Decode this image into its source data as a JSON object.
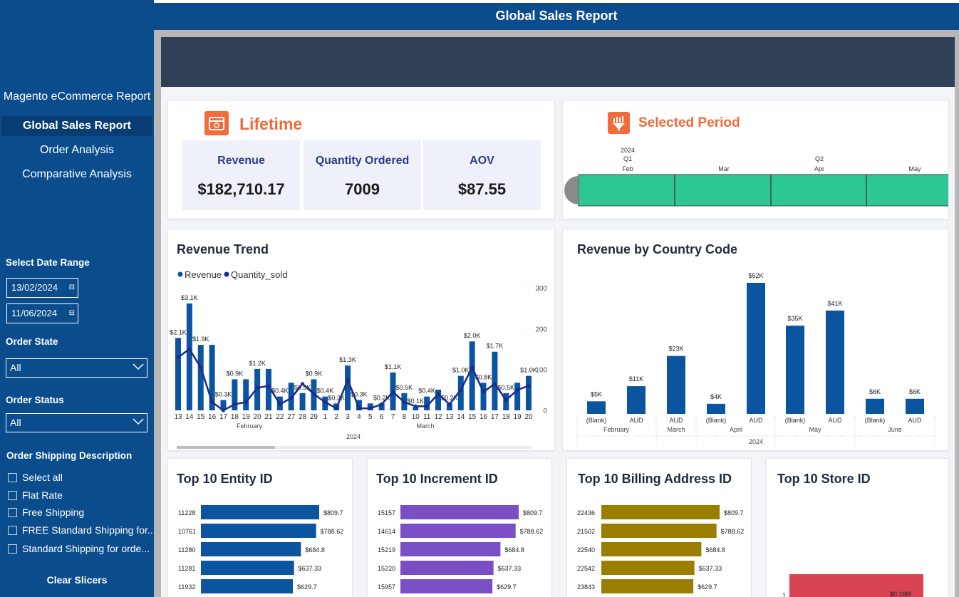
{
  "header": {
    "title": "Global Sales Report"
  },
  "sidebar": {
    "brand": "Magento eCommerce Report",
    "nav": [
      {
        "label": "Global Sales Report",
        "active": true
      },
      {
        "label": "Order Analysis",
        "active": false
      },
      {
        "label": "Comparative Analysis",
        "active": false
      }
    ],
    "date_range_label": "Select Date Range",
    "date_start": "13/02/2024",
    "date_end": "11/06/2024",
    "order_state_label": "Order State",
    "order_state_value": "All",
    "order_status_label": "Order Status",
    "order_status_value": "All",
    "shipping_label": "Order Shipping Description",
    "shipping_options": [
      "Select all",
      "Flat Rate",
      "Free Shipping",
      "FREE Standard Shipping for...",
      "Standard Shipping for orde..."
    ],
    "clear_label": "Clear Slicers"
  },
  "lifetime": {
    "title": "Lifetime",
    "kpis": [
      {
        "label": "Revenue",
        "value": "$182,710.17"
      },
      {
        "label": "Quantity Ordered",
        "value": "7009"
      },
      {
        "label": "AOV",
        "value": "$87.55"
      }
    ]
  },
  "selected_period": {
    "title": "Selected Period",
    "year_label": "2024",
    "quarters": [
      "Q1",
      "Q2"
    ],
    "months": [
      "Feb",
      "Mar",
      "Apr",
      "May"
    ],
    "colors": {
      "fill": "#2dc795",
      "handle": "#8a8a8a"
    }
  },
  "icons": [
    "calendar-icon",
    "period-icon",
    "chevron-down-icon"
  ],
  "colors": {
    "sidebar": "#0a4c8c",
    "accent_orange": "#f06a3a",
    "bar_blue": "#0a54a0",
    "line_navy": "#1c2a8c",
    "purple": "#7a4fc6",
    "olive": "#9a7e00",
    "red": "#d94452"
  },
  "chart_data": [
    {
      "type": "bar+line",
      "title": "Revenue Trend",
      "legend": [
        "Revenue",
        "Quantity_sold"
      ],
      "legend_placement": "top-left",
      "x_groups": [
        "February",
        "March"
      ],
      "x_year": "2024",
      "x": [
        "13",
        "14",
        "15",
        "16",
        "17",
        "18",
        "19",
        "20",
        "21",
        "22",
        "27",
        "28",
        "29",
        "1",
        "2",
        "3",
        "4",
        "5",
        "6",
        "7",
        "8",
        "10",
        "11",
        "12",
        "13",
        "14",
        "15",
        "16",
        "17",
        "18",
        "19",
        "20"
      ],
      "series": [
        {
          "name": "Revenue",
          "values": [
            2100,
            3100,
            1900,
            1900,
            300,
            900,
            900,
            1200,
            1200,
            400,
            800,
            500,
            900,
            400,
            200,
            1300,
            300,
            200,
            200,
            1100,
            500,
            100,
            400,
            600,
            200,
            1000,
            2000,
            800,
            1700,
            500,
            800,
            1000
          ]
        },
        {
          "name": "Quantity_sold",
          "values": [
            130,
            150,
            105,
            20,
            0,
            15,
            20,
            55,
            60,
            15,
            30,
            65,
            40,
            20,
            5,
            75,
            5,
            5,
            15,
            45,
            20,
            10,
            10,
            40,
            15,
            50,
            105,
            45,
            65,
            25,
            50,
            60
          ]
        }
      ],
      "data_labels": [
        "$2.1K",
        "$3.1K",
        "$1.9K",
        "",
        "$0.3K",
        "$0.9K",
        "",
        "$1.2K",
        "",
        "$0.4K",
        "",
        "$0.5K",
        "$0.9K",
        "$0.4K",
        "$0.2K",
        "$1.3K",
        "$0.3K",
        "",
        "$0.2K",
        "$1.1K",
        "$0.5K",
        "$0.1K",
        "$0.4K",
        "",
        "$0.2K",
        "$1.0K",
        "$2.0K",
        "$0.8K",
        "$1.7K",
        "$0.5K",
        "",
        "$1.0K"
      ],
      "y2_ticks": [
        0,
        100,
        200,
        300
      ]
    },
    {
      "type": "bar",
      "title": "Revenue by Country Code",
      "categories": [
        "(Blank)",
        "AUD",
        "AUD",
        "(Blank)",
        "AUD",
        "(Blank)",
        "AUD",
        "(Blank)",
        "AUD"
      ],
      "groups": [
        {
          "name": "February",
          "span": 2
        },
        {
          "name": "March",
          "span": 1
        },
        {
          "name": "April",
          "span": 2
        },
        {
          "name": "May",
          "span": 2
        },
        {
          "name": "June",
          "span": 2
        }
      ],
      "x_year": "2024",
      "values": [
        5000,
        11000,
        23000,
        4000,
        52000,
        35000,
        41000,
        6000,
        6000
      ],
      "labels": [
        "$5K",
        "$11K",
        "$23K",
        "$4K",
        "$52K",
        "$35K",
        "$41K",
        "$6K",
        "$6K"
      ]
    },
    {
      "type": "hbar",
      "title": "Top 10 Entity ID",
      "categories": [
        "11228",
        "10761",
        "11280",
        "11281",
        "11932"
      ],
      "values": [
        809.7,
        788.62,
        684.8,
        637.33,
        629.7
      ],
      "labels": [
        "$809.7",
        "$788.62",
        "$684.8",
        "$637.33",
        "$629.7"
      ],
      "color": "#0a54a0"
    },
    {
      "type": "hbar",
      "title": "Top 10 Increment ID",
      "categories": [
        "15157",
        "14614",
        "15219",
        "15220",
        "15957"
      ],
      "values": [
        809.7,
        788.62,
        684.8,
        637.33,
        629.7
      ],
      "labels": [
        "$809.7",
        "$788.62",
        "$684.8",
        "$637.33",
        "$629.7"
      ],
      "color": "#7a4fc6"
    },
    {
      "type": "hbar",
      "title": "Top 10 Billing Address ID",
      "categories": [
        "22436",
        "21502",
        "22540",
        "22542",
        "23843"
      ],
      "values": [
        809.7,
        788.62,
        684.8,
        637.33,
        629.7
      ],
      "labels": [
        "$809.7",
        "$788.62",
        "$684.8",
        "$637.33",
        "$629.7"
      ],
      "color": "#9a7e00"
    },
    {
      "type": "bar",
      "title": "Top 10 Store ID",
      "categories": [
        "1"
      ],
      "values": [
        180000
      ],
      "labels": [
        "$0.18M"
      ],
      "color": "#d94452"
    }
  ]
}
